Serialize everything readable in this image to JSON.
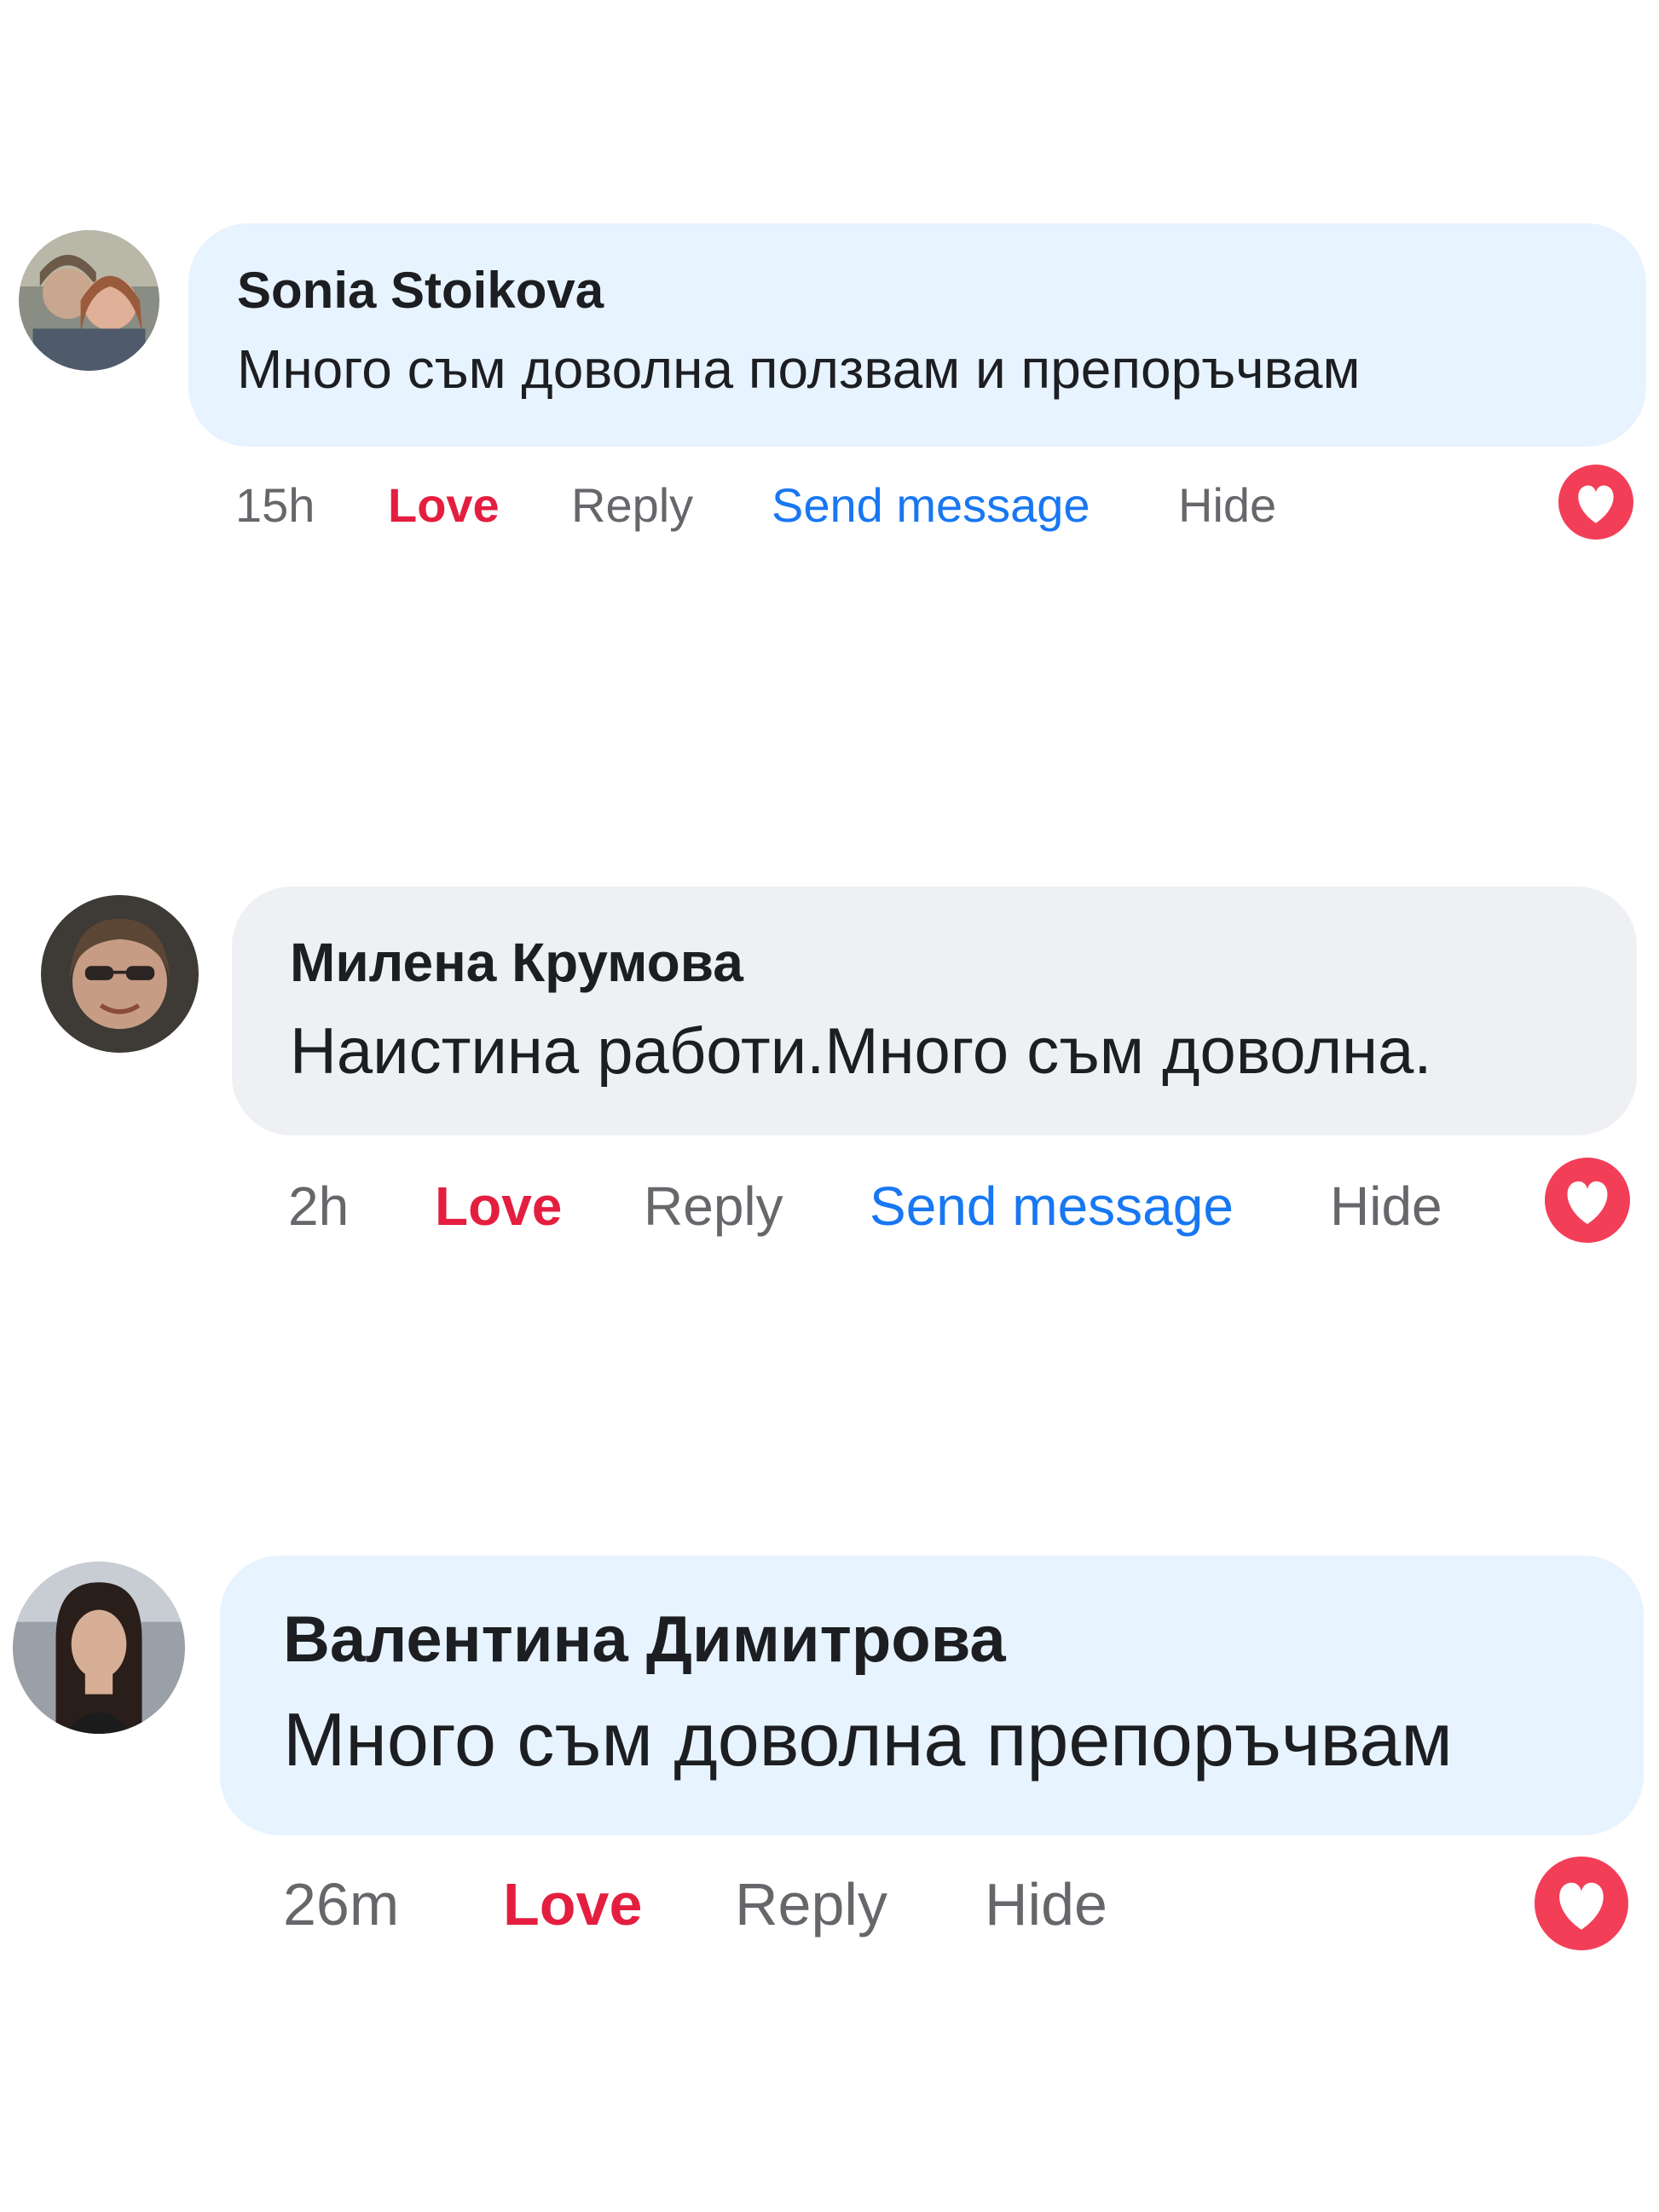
{
  "comments": [
    {
      "author": "Sonia Stoikova",
      "text": "Много съм доволна ползвам и препоръчвам",
      "time": "15h",
      "love_label": "Love",
      "reply_label": "Reply",
      "send_label": "Send message",
      "hide_label": "Hide",
      "reaction_icon": "love-reaction-icon"
    },
    {
      "author": "Милена Крумова",
      "text": "Наистина работи.Много съм доволна.",
      "time": "2h",
      "love_label": "Love",
      "reply_label": "Reply",
      "send_label": "Send message",
      "hide_label": "Hide",
      "reaction_icon": "love-reaction-icon"
    },
    {
      "author": "Валентина Димитрова",
      "text": "Много съм доволна препоръчвам",
      "time": "26m",
      "love_label": "Love",
      "reply_label": "Reply",
      "hide_label": "Hide",
      "reaction_icon": "love-reaction-icon"
    }
  ],
  "colors": {
    "bubble_blue": "#e7f3ff",
    "bubble_grey": "#eef0f3",
    "love_red": "#e41e3f",
    "link_blue": "#1877f2",
    "meta_grey": "#65676b",
    "heart_red": "#f33e58"
  }
}
